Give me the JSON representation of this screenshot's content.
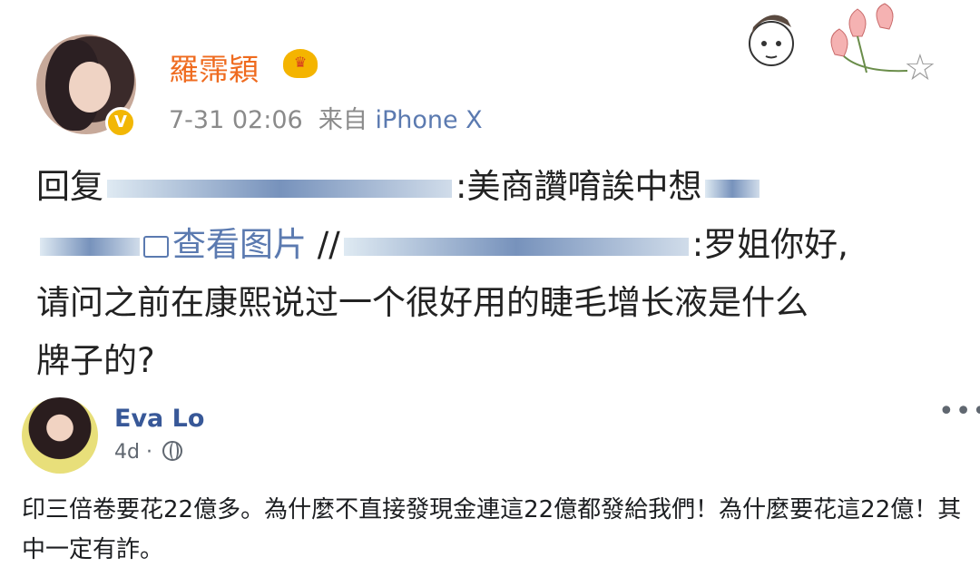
{
  "weibo": {
    "username": "羅霈穎",
    "crown_icon": "crown-icon",
    "verified_icon": "verified-badge-icon",
    "verified_mark": "V",
    "time": "7-31 02:06",
    "source_prefix": "来自",
    "source": "iPhone X",
    "line1_prefix": "回复",
    "line1_suffix": ":美商讚唷誒中想",
    "link_label": "查看图片",
    "separator": "//",
    "line2_suffix": ":罗姐你好,",
    "line3": "请问之前在康熙说过一个很好用的睫毛增长液是什么",
    "line4": "牌子的?"
  },
  "facebook": {
    "name": "Eva Lo",
    "age": "4d",
    "dot": "·",
    "post": "印三倍卷要花22億多。為什麼不直接發現金連這22億都發給我們！為什麼要花這22億！其中一定有詐。",
    "more_icon": "more-icon"
  },
  "colors": {
    "weibo_name": "#ef6b1f",
    "weibo_link": "#5b7ab0",
    "fb_name": "#385898"
  }
}
